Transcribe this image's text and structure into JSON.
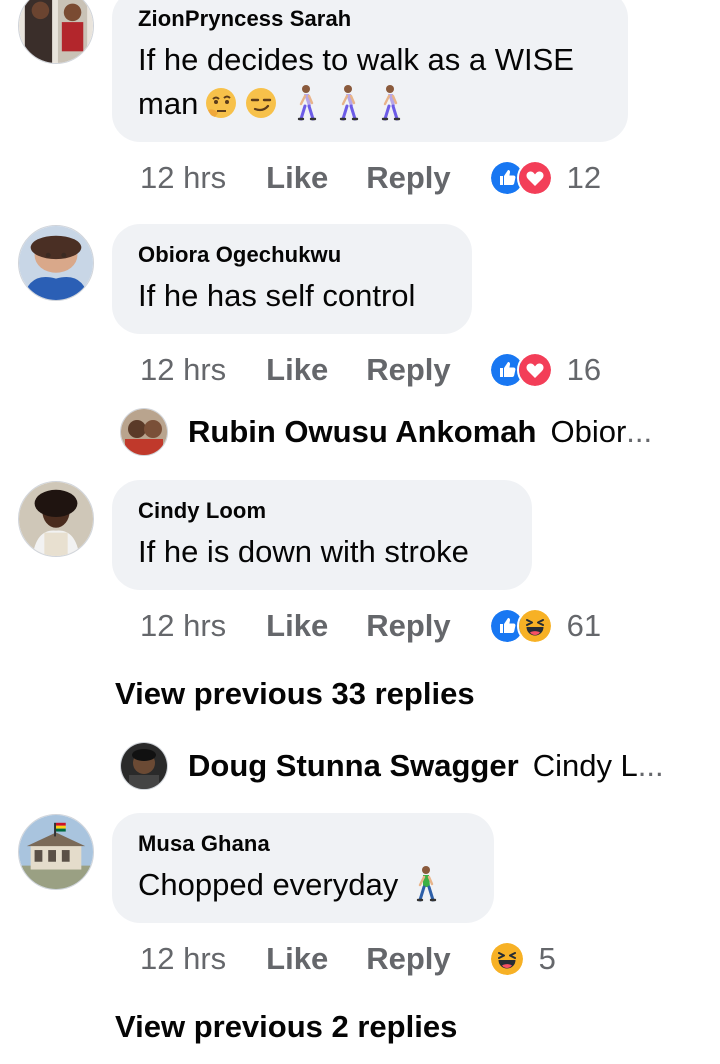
{
  "comments": [
    {
      "name": "ZionPryncess Sarah",
      "line1": "If he decides to walk as a WISE",
      "line2": "man",
      "time": "12 hrs",
      "like": "Like",
      "reply": "Reply",
      "count": "12",
      "reactions": [
        "like-icon",
        "love-icon"
      ]
    },
    {
      "name": "Obiora Ogechukwu",
      "text": "If he has self control",
      "time": "12 hrs",
      "like": "Like",
      "reply": "Reply",
      "count": "16",
      "reactions": [
        "like-icon",
        "love-icon"
      ]
    },
    {
      "name": "Cindy Loom",
      "text": "If he is down with stroke",
      "time": "12 hrs",
      "like": "Like",
      "reply": "Reply",
      "count": "61",
      "reactions": [
        "like-icon",
        "haha-icon"
      ]
    },
    {
      "name": "Musa Ghana",
      "text": "Chopped everyday",
      "time": "12 hrs",
      "like": "Like",
      "reply": "Reply",
      "count": "5",
      "reactions": [
        "haha-icon"
      ]
    }
  ],
  "replies": [
    {
      "name": "Rubin Owusu Ankomah",
      "snippet": "Obior",
      "ellipsis": "..."
    },
    {
      "name": "Doug Stunna Swagger",
      "snippet": "Cindy L",
      "ellipsis": "..."
    }
  ],
  "view_previous": [
    "View previous 33 replies",
    "View previous 2 replies"
  ],
  "colors": {
    "bubble": "#f0f2f5",
    "meta": "#65676b",
    "like_blue": "#1877f2",
    "love_red": "#f33e58",
    "haha_yellow": "#f7b125"
  }
}
